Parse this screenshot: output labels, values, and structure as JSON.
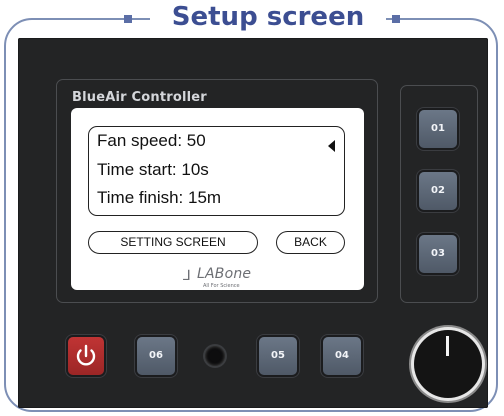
{
  "header": {
    "title": "Setup screen"
  },
  "device": {
    "brand": "BlueAir Controller",
    "lcd": {
      "lines": [
        "Fan speed: 50",
        "Time start: 10s",
        "Time finish: 15m"
      ],
      "buttons": {
        "setting": "SETTING SCREEN",
        "back": "BACK"
      },
      "logo": {
        "name": "LABone",
        "tagline": "All For Science"
      }
    },
    "side_keys": [
      "01",
      "02",
      "03"
    ],
    "bottom_keys": [
      "06",
      "05",
      "04"
    ]
  }
}
